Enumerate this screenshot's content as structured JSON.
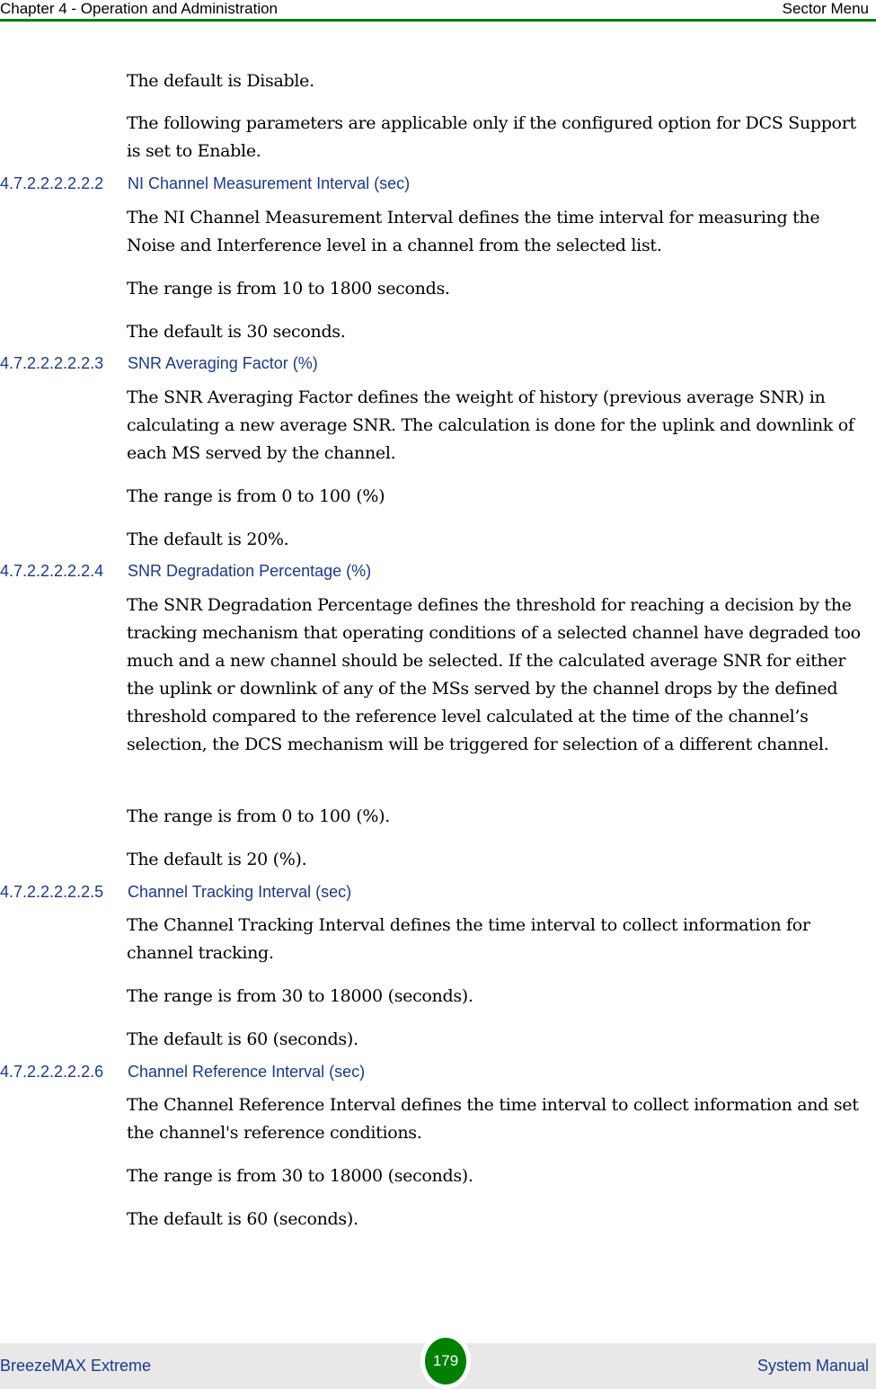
{
  "header": {
    "chapter": "Chapter 4 - Operation and Administration",
    "section": "Sector Menu"
  },
  "intro": [
    "The default is Disable.",
    "The following parameters are applicable only if the configured option for DCS Support is set to Enable."
  ],
  "sections": [
    {
      "number": "4.7.2.2.2.2.2.2",
      "title": "NI Channel Measurement Interval (sec)",
      "paragraphs": [
        "The NI Channel Measurement Interval defines the time interval for measuring the Noise and Interference level in a channel from the selected list.",
        "The range is from 10 to 1800 seconds.",
        "The default is 30 seconds."
      ]
    },
    {
      "number": "4.7.2.2.2.2.2.3",
      "title": "SNR Averaging Factor (%)",
      "paragraphs": [
        "The SNR Averaging Factor defines the weight of history (previous average SNR) in calculating a new average SNR. The calculation is done for the uplink and downlink of each MS served by the channel.",
        "The range is from 0 to 100 (%)",
        "The default is 20%."
      ]
    },
    {
      "number": "4.7.2.2.2.2.2.4",
      "title": "SNR Degradation Percentage (%)",
      "paragraphs": [
        "The SNR Degradation Percentage defines the threshold for reaching a decision by the tracking mechanism that operating conditions of a selected channel have degraded too much and a new channel should be selected. If the calculated average SNR for either the uplink or downlink of any of the MSs served by the channel drops by the defined threshold compared to the reference level calculated at the time of the channel’s selection, the DCS mechanism will be triggered for selection of a different channel.",
        "The range is from 0 to 100 (%).",
        "The default is 20 (%)."
      ]
    },
    {
      "number": "4.7.2.2.2.2.2.5",
      "title": "Channel Tracking Interval (sec)",
      "paragraphs": [
        "The Channel Tracking Interval defines the time interval to collect information for channel tracking.",
        "The range is from 30 to 18000 (seconds).",
        "The default is 60 (seconds)."
      ]
    },
    {
      "number": "4.7.2.2.2.2.2.6",
      "title": "Channel Reference Interval (sec)",
      "paragraphs": [
        "The Channel Reference Interval defines the time interval to collect information and set the channel's reference conditions.",
        "The range is from 30 to 18000 (seconds).",
        "The default is 60 (seconds)."
      ]
    }
  ],
  "footer": {
    "product": "BreezeMAX Extreme",
    "page_number": "179",
    "doc_type": "System Manual"
  }
}
